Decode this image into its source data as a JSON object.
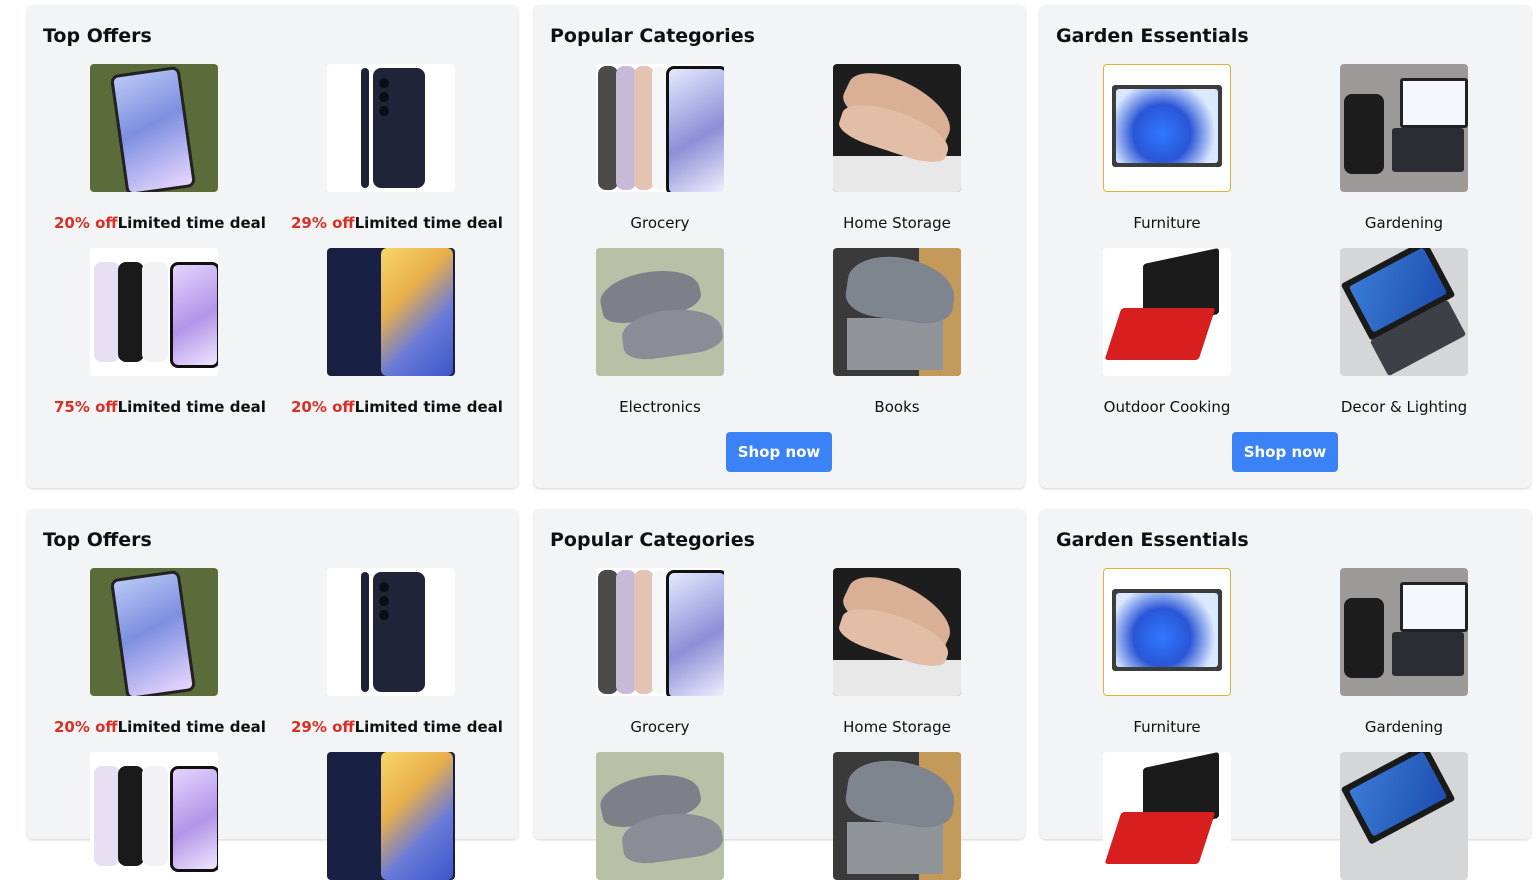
{
  "row1": {
    "offers": {
      "title": "Top Offers",
      "items": [
        {
          "pct": "20% off",
          "label": "Limited time deal"
        },
        {
          "pct": "29% off",
          "label": "Limited time deal"
        },
        {
          "pct": "75% off",
          "label": "Limited time deal"
        },
        {
          "pct": "20% off",
          "label": "Limited time deal"
        }
      ]
    },
    "categories": {
      "title": "Popular Categories",
      "items": [
        {
          "label": "Grocery"
        },
        {
          "label": "Home Storage"
        },
        {
          "label": "Electronics"
        },
        {
          "label": "Books"
        }
      ],
      "button": "Shop now"
    },
    "garden": {
      "title": "Garden Essentials",
      "items": [
        {
          "label": "Furniture"
        },
        {
          "label": "Gardening"
        },
        {
          "label": "Outdoor Cooking"
        },
        {
          "label": "Decor & Lighting"
        }
      ],
      "button": "Shop now"
    }
  },
  "row2": {
    "offers": {
      "title": "Top Offers",
      "items": [
        {
          "pct": "20% off",
          "label": "Limited time deal"
        },
        {
          "pct": "29% off",
          "label": "Limited time deal"
        }
      ]
    },
    "categories": {
      "title": "Popular Categories",
      "items": [
        {
          "label": "Grocery"
        },
        {
          "label": "Home Storage"
        }
      ]
    },
    "garden": {
      "title": "Garden Essentials",
      "items": [
        {
          "label": "Furniture"
        },
        {
          "label": "Gardening"
        }
      ]
    }
  },
  "colors": {
    "accent": "#3b82f6",
    "deal": "#d93025",
    "card": "#f3f4f6"
  }
}
